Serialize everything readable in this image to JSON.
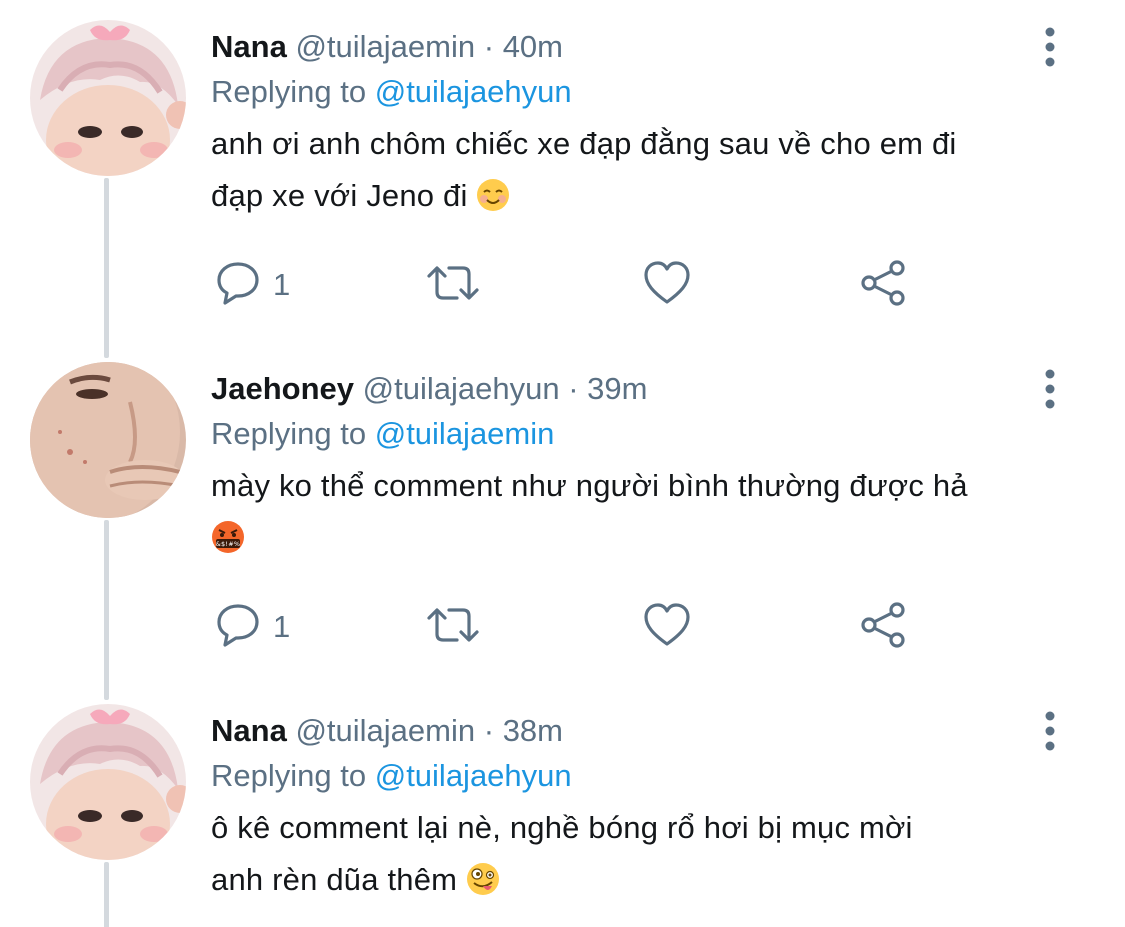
{
  "tweets": [
    {
      "name": "Nana",
      "handle": "@tuilajaemin",
      "separator": "·",
      "time": "40m",
      "replying_label": "Replying to",
      "replying_to": "@tuilajaehyun",
      "line1": "anh ơi anh chôm chiếc xe đạp đằng sau về cho em đi",
      "line2": "đạp xe với Jeno đi",
      "emoji": "smiling-face-emoji",
      "reply_count": "1",
      "avatar": "pink-hair-avatar"
    },
    {
      "name": "Jaehoney",
      "handle": "@tuilajaehyun",
      "separator": "·",
      "time": "39m",
      "replying_label": "Replying to",
      "replying_to": "@tuilajaemin",
      "line1": "mày ko thể comment như người bình thường được hả",
      "line2": "",
      "emoji": "cursing-face-emoji",
      "emoji_text": "&$!#%",
      "reply_count": "1",
      "avatar": "face-closeup-avatar"
    },
    {
      "name": "Nana",
      "handle": "@tuilajaemin",
      "separator": "·",
      "time": "38m",
      "replying_label": "Replying to",
      "replying_to": "@tuilajaehyun",
      "line1": "ô kê comment lại nè, nghề bóng rổ hơi bị mục mời",
      "line2": "anh rèn dũa thêm",
      "emoji": "zany-face-emoji",
      "avatar": "pink-hair-avatar"
    }
  ],
  "icons": {
    "reply": "reply-icon",
    "retweet": "retweet-icon",
    "like": "heart-icon",
    "share": "share-icon",
    "more": "more-vertical-icon"
  },
  "colors": {
    "link": "#1b95e0",
    "secondary_text": "#5b7083",
    "primary_text": "#14171a",
    "thread_line": "#d4d9de"
  }
}
